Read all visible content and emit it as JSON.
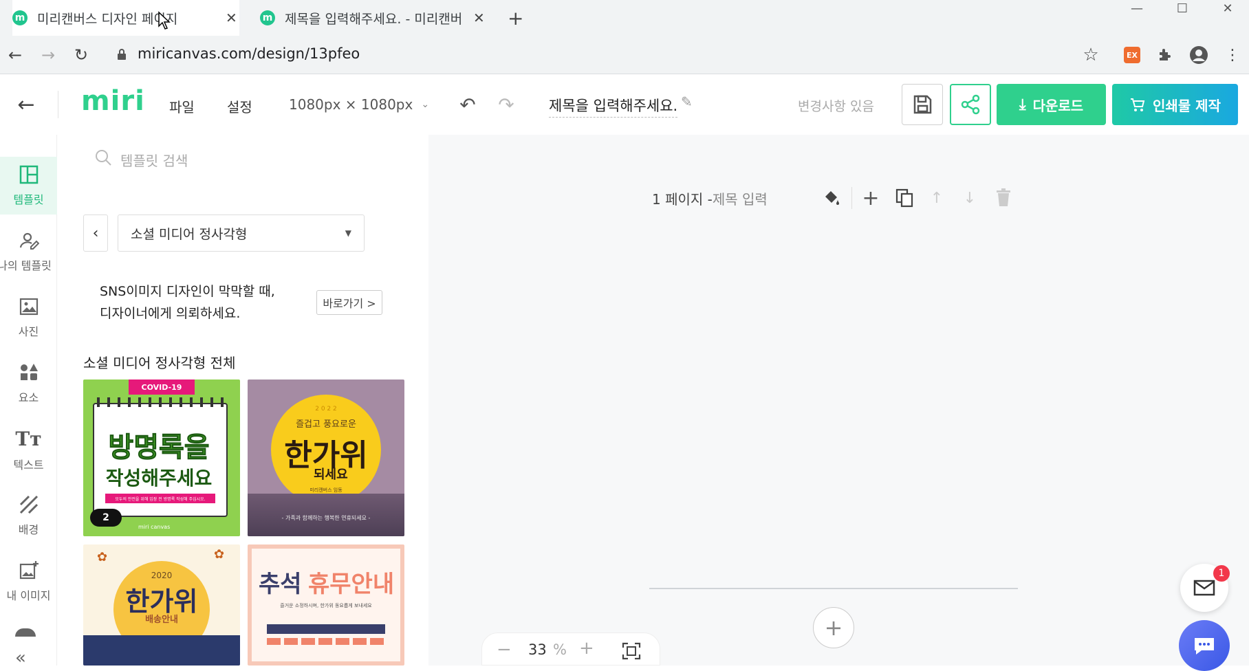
{
  "browser": {
    "tabs": [
      {
        "title": "미리캔버스 디자인 페이지",
        "favicon": "m"
      },
      {
        "title": "제목을 입력해주세요. - 미리캔버",
        "favicon": "m"
      }
    ],
    "new_tab": "+",
    "url": "miricanvas.com/design/13pfeo",
    "ext_badge": "EX"
  },
  "header": {
    "logo": "miri",
    "menu_file": "파일",
    "menu_settings": "설정",
    "size": "1080px × 1080px",
    "doc_title": "제목을 입력해주세요.",
    "status": "변경사항 있음",
    "download": "다운로드",
    "print": "인쇄물 제작"
  },
  "rail": {
    "items": [
      {
        "label": "템플릿",
        "icon": "template-icon"
      },
      {
        "label": "나의 템플릿",
        "icon": "my-template-icon"
      },
      {
        "label": "사진",
        "icon": "photo-icon"
      },
      {
        "label": "요소",
        "icon": "elements-icon"
      },
      {
        "label": "텍스트",
        "icon": "text-icon"
      },
      {
        "label": "배경",
        "icon": "background-icon"
      },
      {
        "label": "내 이미지",
        "icon": "my-image-icon"
      }
    ]
  },
  "panel": {
    "search_placeholder": "템플릿 검색",
    "category": "소셜 미디어 정사각형",
    "promo_line1": "SNS이미지 디자인이 막막할 때,",
    "promo_line2": "디자이너에게 의뢰하세요.",
    "promo_btn": "바로가기 >",
    "section_title": "소셜 미디어 정사각형 전체",
    "thumbs": [
      {
        "badge": "COVID-19",
        "line1": "방명록을",
        "line2": "작성해주세요",
        "note": "모두의 안전을 위해 입장 전 방명록 작성해 주십시오.",
        "count": "2",
        "brand": "miri canvas"
      },
      {
        "year": "2 0 2 2",
        "line1": "즐겁고 풍요로운",
        "line2": "한가위",
        "line3": "되세요",
        "sign": "미리캔버스 임동",
        "footer": "- 가족과 함께하는 행복한 연휴되세요 -"
      },
      {
        "year": "2020",
        "line1": "한가위",
        "line2": "배송안내"
      },
      {
        "line1": "추석",
        "line2": "휴무안내",
        "sub": "즐거운 소정하시며, 한가위 동요롭게 보내세요"
      }
    ]
  },
  "canvas": {
    "page_label": "1 페이지 - ",
    "page_title_placeholder": "제목 입력",
    "zoom_value": "33",
    "zoom_unit": "%",
    "zoom_minus": "−",
    "zoom_plus": "+",
    "add_page": "+",
    "chat_badge": "1"
  },
  "colors": {
    "brand_green": "#21c58e",
    "download_bg": "#2fd08d",
    "print_bg": "#1fb8c9"
  }
}
